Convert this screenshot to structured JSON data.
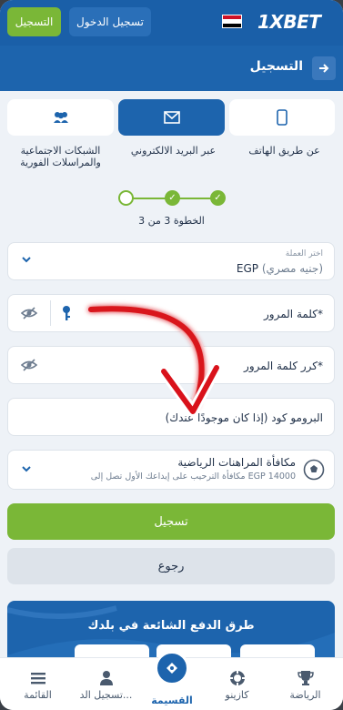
{
  "header": {
    "register_label": "التسجيل",
    "login_label": "تسجيل الدخول",
    "logo_prefix": "1X",
    "logo_suffix": "BET"
  },
  "registration": {
    "title": "التسجيل",
    "tabs": [
      {
        "label": "عن طريق الهاتف",
        "icon": "phone-icon"
      },
      {
        "label": "عبر البريد الالكتروني",
        "icon": "envelope-icon",
        "active": true
      },
      {
        "label": "الشبكات الاجتماعية والمراسلات الفورية",
        "icon": "users-icon"
      }
    ],
    "step_text": "الخطوة 3 من 3",
    "currency": {
      "label": "اختر العملة",
      "code": "EGP",
      "name": "(جنيه مصري)"
    },
    "password_placeholder": "كلمة المرور*",
    "confirm_password_placeholder": "كرر كلمة المرور*",
    "promo_placeholder": "البرومو كود (إذا كان موجودًا عندك)",
    "bonus": {
      "title": "مكافأة المراهنات الرياضية",
      "desc": "مكافأة الترحيب على إيداعك الأول تصل إلى EGP 14000"
    },
    "submit_label": "تسجيل",
    "back_label": "رجوع"
  },
  "payment_banner": {
    "title": "طرق الدفع الشائعة في بلدك"
  },
  "bottom_nav": [
    {
      "label": "الرياضة",
      "icon": "trophy-icon"
    },
    {
      "label": "كازينو",
      "icon": "casino-chip-icon"
    },
    {
      "label": "القسيمة",
      "icon": "coupon-icon",
      "active": true
    },
    {
      "label": "تسجيل الد...",
      "icon": "user-icon"
    },
    {
      "label": "القائمة",
      "icon": "menu-icon"
    }
  ],
  "colors": {
    "brand_blue": "#1d64ad",
    "accent_green": "#7ab737",
    "background": "#eef2f7"
  }
}
